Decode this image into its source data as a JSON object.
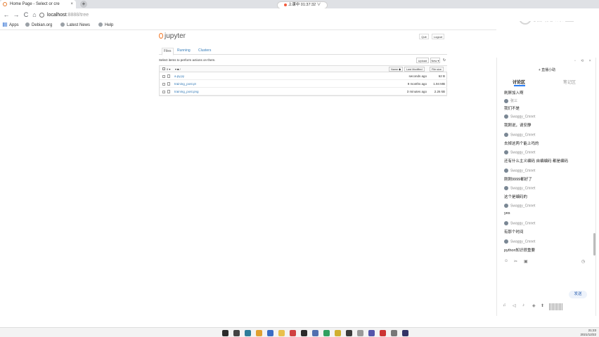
{
  "browser": {
    "tab_title": "Home Page - Select or cre",
    "tab_close": "×",
    "new_tab": "+",
    "nav_back": "←",
    "nav_forward": "→",
    "nav_reload": "C",
    "nav_home": "⌂",
    "url_host": "localhost",
    "url_path": ":8888/tree",
    "bookmarks": [
      "Apps",
      "Debian.org",
      "Latest News",
      "Help"
    ]
  },
  "timer": {
    "label": "上课中 01:37:32",
    "icon": "∨"
  },
  "brand": {
    "text": "猎视课堂"
  },
  "jupyter": {
    "logo_text": "jupyter",
    "quit_label": "Quit",
    "logout_label": "Logout",
    "tabs": [
      "Files",
      "Running",
      "Clusters"
    ],
    "hint": "Select items to perform actions on them.",
    "upload_label": "Upload",
    "new_label": "New ▾",
    "refresh_icon": "↻",
    "header": {
      "count": "0 ▾",
      "folder": "▾ ■ /",
      "name_col": "Name ◆",
      "modified_col": "Last Modified",
      "size_col": "File size"
    },
    "files": [
      {
        "name": "a.py.py",
        "modified": "seconds ago",
        "size": "62 B"
      },
      {
        "name": "training_post.pt",
        "modified": "9 months ago",
        "size": "1.94 MB"
      },
      {
        "name": "training_post.png",
        "modified": "3 minutes ago",
        "size": "2.26 kB"
      }
    ]
  },
  "chat": {
    "top_icons": "▫ ⟲ ×",
    "live_title": "+ 直播小助",
    "tab_discuss": "讨论区",
    "tab_notes": "笔记区",
    "messages": [
      {
        "user": "",
        "text": "刷屏加入啊"
      },
      {
        "user": "张三",
        "text": "我们不是"
      },
      {
        "user": "Swaggy_Cmnet",
        "text": "我刚说，请安静"
      },
      {
        "user": "Swaggy_Cmnet",
        "text": "去掉这两个能上吗的"
      },
      {
        "user": "Swaggy_Cmnet",
        "text": "还有什么主义编码 自编编码 都是编码"
      },
      {
        "user": "Swaggy_Cmnet",
        "text": "刚刚9999都好了"
      },
      {
        "user": "Swaggy_Cmnet",
        "text": "这个是编码的"
      },
      {
        "user": "Swaggy_Cmnet",
        "text": "yes"
      },
      {
        "user": "Swaggy_Cmnet",
        "text": "有那个时间"
      },
      {
        "user": "Swaggy_Cmnet",
        "text": "python知识很重要"
      }
    ],
    "tools": [
      "☺",
      "✂",
      "▣",
      "◷"
    ],
    "send_label": "发送",
    "bottom_icons": [
      "♫",
      "◁",
      "♪",
      "◈",
      "⬆"
    ]
  },
  "taskbar": {
    "time": "21:23",
    "date": "2021/12/22",
    "colors": [
      "#2b2b2b",
      "#444",
      "#2d7d9a",
      "#e0a030",
      "#3a6cc4",
      "#e9c04c",
      "#d04040",
      "#2a2a2a",
      "#5070b0",
      "#30a060",
      "#d0b030",
      "#3b3b3b",
      "#999",
      "#55a",
      "#c33",
      "#777",
      "#336"
    ]
  }
}
